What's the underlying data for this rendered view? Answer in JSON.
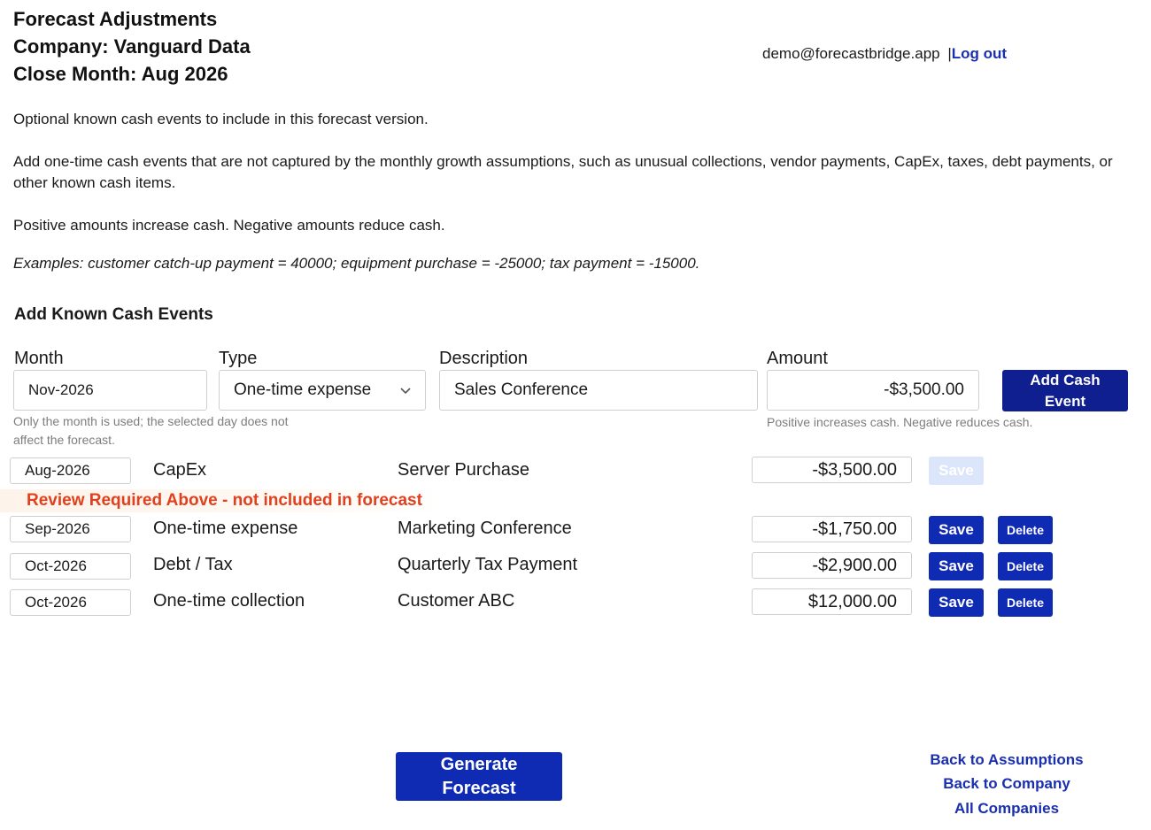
{
  "header": {
    "title": "Forecast Adjustments",
    "company_line": "Company:  Vanguard Data",
    "close_month_line": "Close Month:  Aug 2026"
  },
  "user": {
    "email": "demo@forecastbridge.app",
    "separator": "|",
    "logout_label": "Log out"
  },
  "intro": {
    "p1": "Optional known cash events to include in this forecast version.",
    "p2": "Add one-time cash events that are not captured by the monthly growth assumptions, such as unusual collections, vendor payments, CapEx, taxes, debt payments, or other known cash items.",
    "p3": "Positive amounts increase cash. Negative amounts reduce cash.",
    "examples": "Examples: customer catch-up payment = 40000; equipment purchase = -25000; tax payment = -15000."
  },
  "add_form": {
    "section_title": "Add Known Cash Events",
    "month_label": "Month",
    "month_value": "Nov-2026",
    "type_label": "Type",
    "type_value": "One-time expense",
    "description_label": "Description",
    "description_value": "Sales Conference",
    "amount_label": "Amount",
    "amount_value": "-$3,500.00",
    "add_button": "Add Cash Event",
    "month_help": "Only the month is used; the selected day does not affect the forecast.",
    "amount_help": "Positive increases cash. Negative reduces cash."
  },
  "events": {
    "rows": [
      {
        "month": "Aug-2026",
        "type": "CapEx",
        "description": "Server Purchase",
        "amount": "-$3,500.00",
        "save": "Save",
        "save_disabled": true
      },
      {
        "month": "Sep-2026",
        "type": "One-time expense",
        "description": "Marketing Conference",
        "amount": "-$1,750.00",
        "save": "Save",
        "delete": "Delete"
      },
      {
        "month": "Oct-2026",
        "type": "Debt / Tax",
        "description": "Quarterly Tax Payment",
        "amount": "-$2,900.00",
        "save": "Save",
        "delete": "Delete"
      },
      {
        "month": "Oct-2026",
        "type": "One-time collection",
        "description": "Customer ABC",
        "amount": "$12,000.00",
        "save": "Save",
        "delete": "Delete"
      }
    ],
    "warning": "Review Required Above - not included in forecast"
  },
  "footer": {
    "generate_button": "Generate Forecast",
    "links": [
      "Back to Assumptions",
      "Back to Company",
      "All Companies"
    ]
  },
  "colors": {
    "primary_button": "#0f2ab3",
    "dark_button": "#0f1f8f",
    "link": "#1a2eb0",
    "warning_text": "#e0401e",
    "disabled_button": "#dce6fb"
  },
  "icons": {
    "select_chevron": "chevron-down-icon"
  }
}
